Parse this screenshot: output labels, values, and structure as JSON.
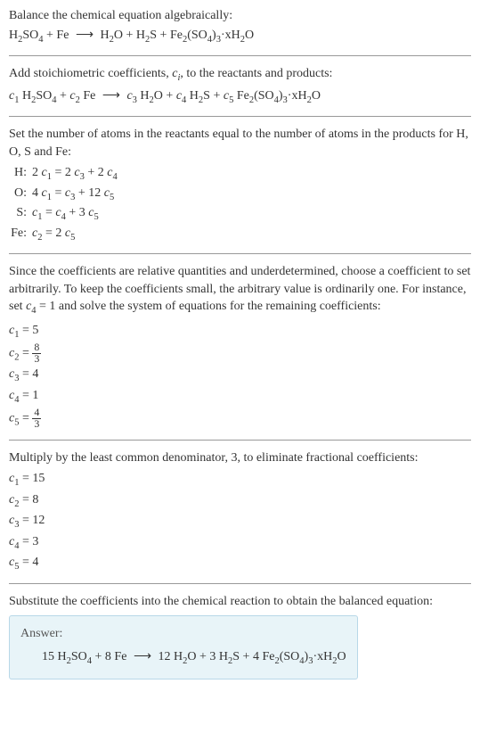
{
  "section1": {
    "title": "Balance the chemical equation algebraically:",
    "eq_lhs_1": "H",
    "eq_lhs_2": "SO",
    "eq_plus1": " + Fe ",
    "eq_arrow": "⟶",
    "eq_rhs_1": " H",
    "eq_rhs_2": "O + H",
    "eq_rhs_3": "S + Fe",
    "eq_rhs_4": "(SO",
    "eq_rhs_5": ")",
    "eq_rhs_6": "·xH",
    "eq_rhs_7": "O"
  },
  "section2": {
    "title_a": "Add stoichiometric coefficients, ",
    "title_ci": "c",
    "title_b": ", to the reactants and products:",
    "c1": "c",
    "sp1": " H",
    "sp2": "SO",
    "plus1": " + ",
    "c2": "c",
    "sp3": " Fe ",
    "arrow": "⟶",
    "sp4": " ",
    "c3": "c",
    "sp5": " H",
    "sp6": "O + ",
    "c4": "c",
    "sp7": " H",
    "sp8": "S + ",
    "c5": "c",
    "sp9": " Fe",
    "sp10": "(SO",
    "sp11": ")",
    "sp12": "·xH",
    "sp13": "O"
  },
  "section3": {
    "text": "Set the number of atoms in the reactants equal to the number of atoms in the products for H, O, S and Fe:",
    "rows": {
      "H_label": "H:",
      "H_eq_a": "2 ",
      "H_c1": "c",
      "H_eq_b": " = 2 ",
      "H_c3": "c",
      "H_eq_c": " + 2 ",
      "H_c4": "c",
      "O_label": "O:",
      "O_eq_a": "4 ",
      "O_c1": "c",
      "O_eq_b": " = ",
      "O_c3": "c",
      "O_eq_c": " + 12 ",
      "O_c5": "c",
      "S_label": "S:",
      "S_c1": "c",
      "S_eq_a": " = ",
      "S_c4": "c",
      "S_eq_b": " + 3 ",
      "S_c5": "c",
      "Fe_label": "Fe:",
      "Fe_c2": "c",
      "Fe_eq_a": " = 2 ",
      "Fe_c5": "c"
    }
  },
  "section4": {
    "text_a": "Since the coefficients are relative quantities and underdetermined, choose a coefficient to set arbitrarily. To keep the coefficients small, the arbitrary value is ordinarily one. For instance, set ",
    "c4": "c",
    "text_b": " = 1 and solve the system of equations for the remaining coefficients:",
    "coefs": {
      "c1_lhs": "c",
      "c1_rhs": " = 5",
      "c2_lhs": "c",
      "c2_eq": " = ",
      "c2_num": "8",
      "c2_den": "3",
      "c3_lhs": "c",
      "c3_rhs": " = 4",
      "c4_lhs": "c",
      "c4_rhs": " = 1",
      "c5_lhs": "c",
      "c5_eq": " = ",
      "c5_num": "4",
      "c5_den": "3"
    }
  },
  "section5": {
    "text": "Multiply by the least common denominator, 3, to eliminate fractional coefficients:",
    "coefs": {
      "c1_lhs": "c",
      "c1_rhs": " = 15",
      "c2_lhs": "c",
      "c2_rhs": " = 8",
      "c3_lhs": "c",
      "c3_rhs": " = 12",
      "c4_lhs": "c",
      "c4_rhs": " = 3",
      "c5_lhs": "c",
      "c5_rhs": " = 4"
    }
  },
  "section6": {
    "text": "Substitute the coefficients into the chemical reaction to obtain the balanced equation:",
    "answer_label": "Answer:",
    "eq_a": "15 H",
    "eq_b": "SO",
    "eq_c": " + 8 Fe ",
    "arrow": "⟶",
    "eq_d": " 12 H",
    "eq_e": "O + 3 H",
    "eq_f": "S + 4 Fe",
    "eq_g": "(SO",
    "eq_h": ")",
    "eq_i": "·xH",
    "eq_j": "O"
  },
  "subs": {
    "s1": "1",
    "s2": "2",
    "s3": "3",
    "s4": "4",
    "s5": "5",
    "si": "i"
  }
}
